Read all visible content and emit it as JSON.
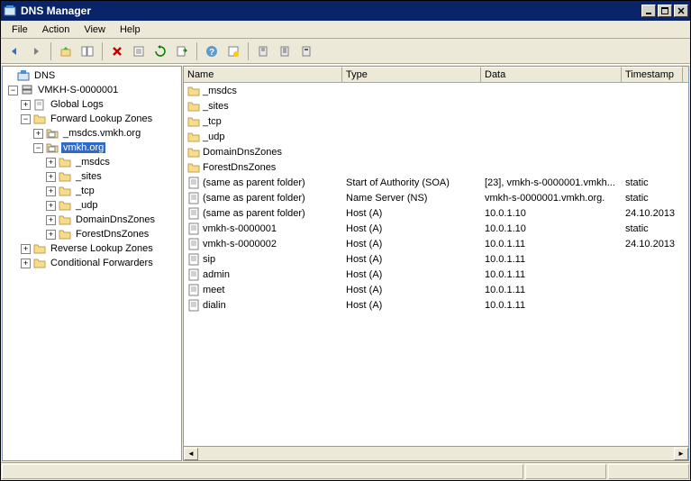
{
  "window": {
    "title": "DNS Manager"
  },
  "menu": {
    "file": "File",
    "action": "Action",
    "view": "View",
    "help": "Help"
  },
  "tree": {
    "root": "DNS",
    "server": "VMKH-S-0000001",
    "global_logs": "Global Logs",
    "flz": "Forward Lookup Zones",
    "zone_msdcs": "_msdcs.vmkh.org",
    "zone_vmkh": "vmkh.org",
    "sub_msdcs": "_msdcs",
    "sub_sites": "_sites",
    "sub_tcp": "_tcp",
    "sub_udp": "_udp",
    "sub_ddz": "DomainDnsZones",
    "sub_fdz": "ForestDnsZones",
    "rlz": "Reverse Lookup Zones",
    "cf": "Conditional Forwarders"
  },
  "columns": {
    "name": "Name",
    "type": "Type",
    "data": "Data",
    "timestamp": "Timestamp"
  },
  "rows": [
    {
      "name": "_msdcs",
      "type": "",
      "data": "",
      "ts": "",
      "icon": "folder"
    },
    {
      "name": "_sites",
      "type": "",
      "data": "",
      "ts": "",
      "icon": "folder"
    },
    {
      "name": "_tcp",
      "type": "",
      "data": "",
      "ts": "",
      "icon": "folder"
    },
    {
      "name": "_udp",
      "type": "",
      "data": "",
      "ts": "",
      "icon": "folder"
    },
    {
      "name": "DomainDnsZones",
      "type": "",
      "data": "",
      "ts": "",
      "icon": "folder"
    },
    {
      "name": "ForestDnsZones",
      "type": "",
      "data": "",
      "ts": "",
      "icon": "folder"
    },
    {
      "name": "(same as parent folder)",
      "type": "Start of Authority (SOA)",
      "data": "[23], vmkh-s-0000001.vmkh...",
      "ts": "static",
      "icon": "record"
    },
    {
      "name": "(same as parent folder)",
      "type": "Name Server (NS)",
      "data": "vmkh-s-0000001.vmkh.org.",
      "ts": "static",
      "icon": "record"
    },
    {
      "name": "(same as parent folder)",
      "type": "Host (A)",
      "data": "10.0.1.10",
      "ts": "24.10.2013",
      "icon": "record"
    },
    {
      "name": "vmkh-s-0000001",
      "type": "Host (A)",
      "data": "10.0.1.10",
      "ts": "static",
      "icon": "record"
    },
    {
      "name": "vmkh-s-0000002",
      "type": "Host (A)",
      "data": "10.0.1.11",
      "ts": "24.10.2013",
      "icon": "record"
    },
    {
      "name": "sip",
      "type": "Host (A)",
      "data": "10.0.1.11",
      "ts": "",
      "icon": "record"
    },
    {
      "name": "admin",
      "type": "Host (A)",
      "data": "10.0.1.11",
      "ts": "",
      "icon": "record"
    },
    {
      "name": "meet",
      "type": "Host (A)",
      "data": "10.0.1.11",
      "ts": "",
      "icon": "record"
    },
    {
      "name": "dialin",
      "type": "Host (A)",
      "data": "10.0.1.11",
      "ts": "",
      "icon": "record"
    }
  ]
}
